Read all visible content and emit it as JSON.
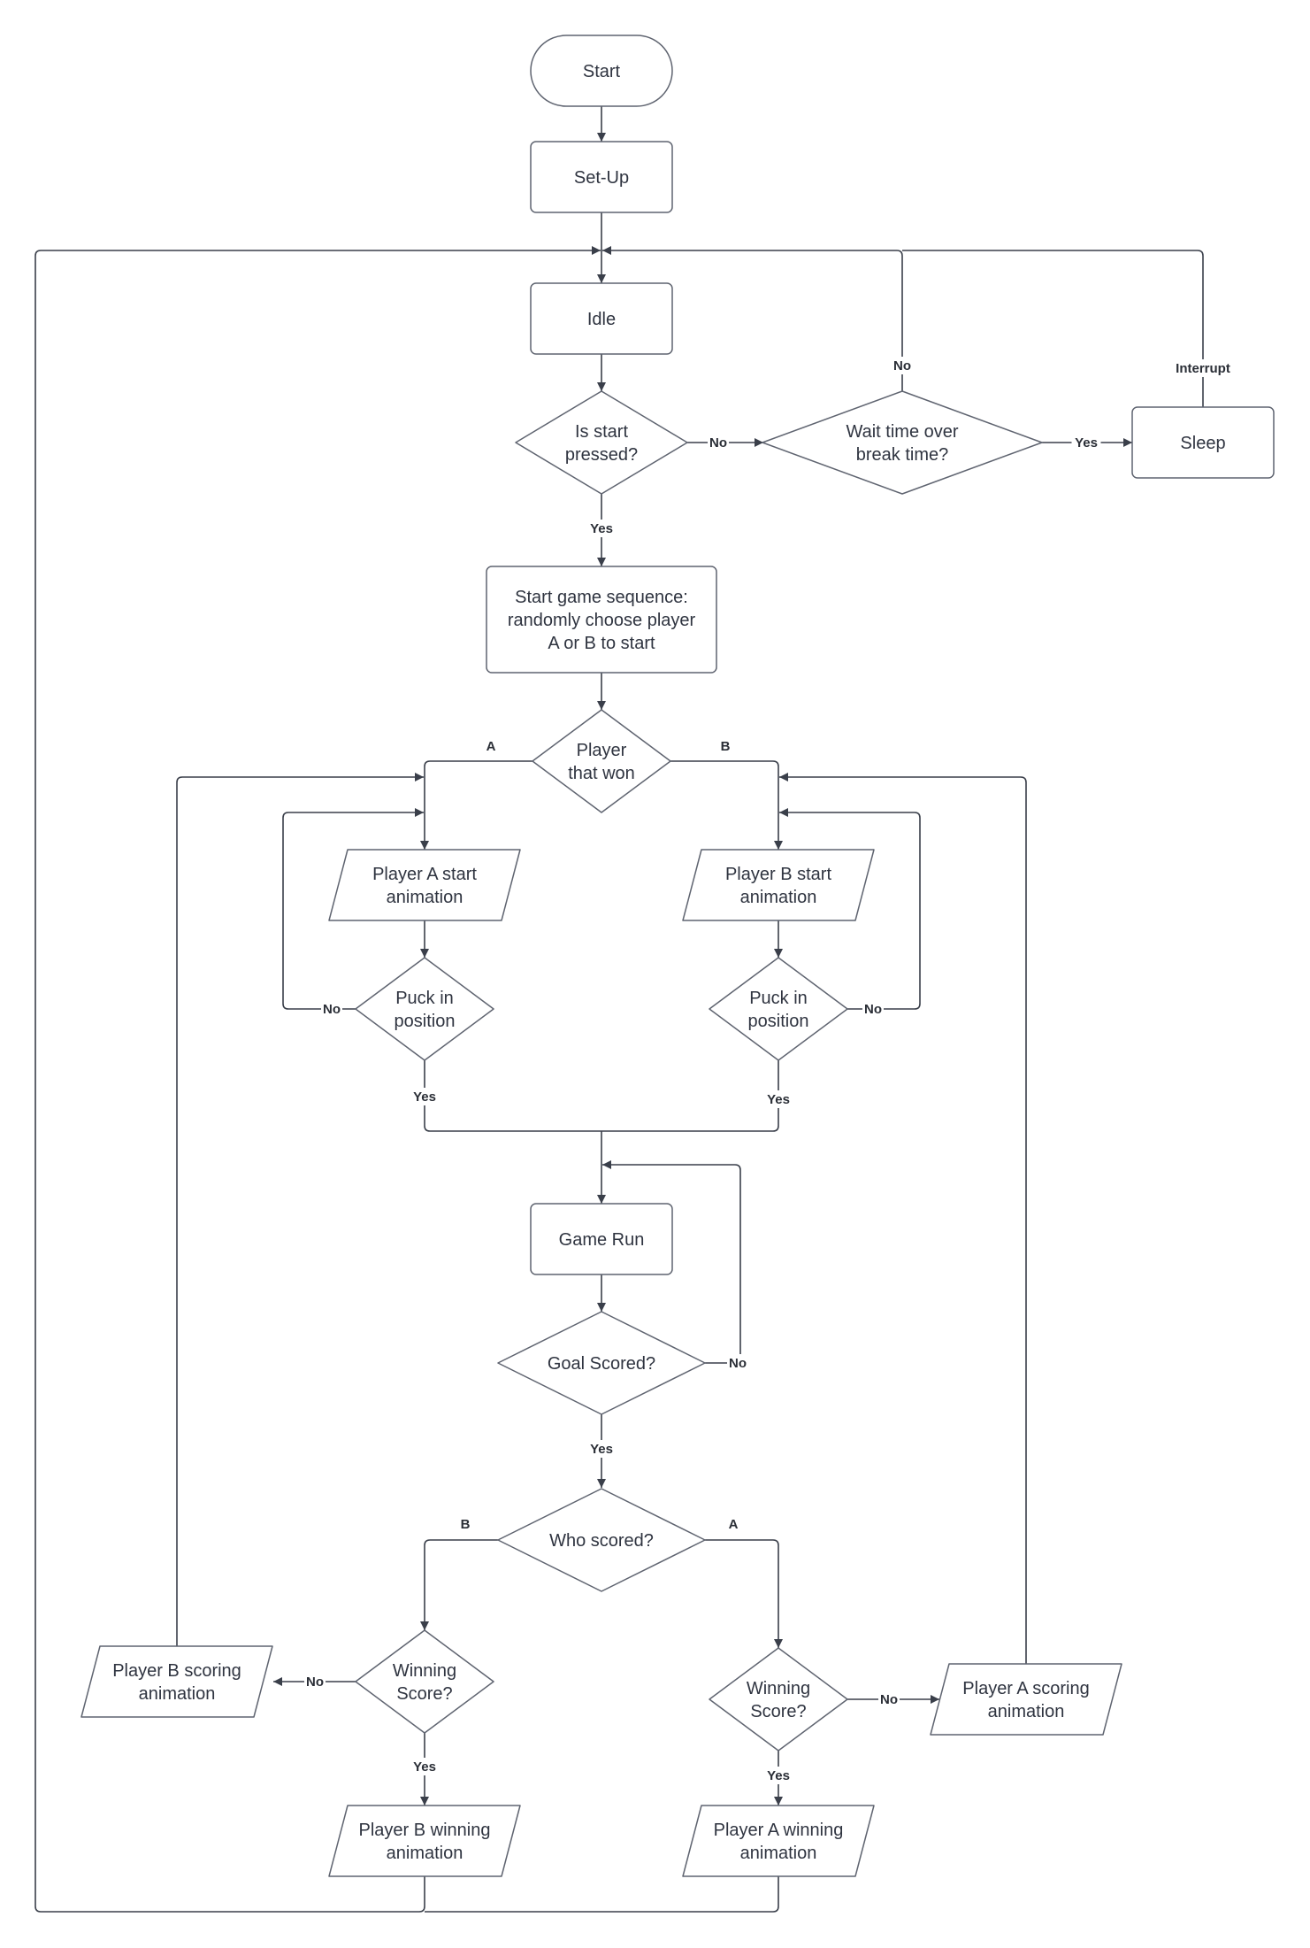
{
  "diagram": {
    "type": "flowchart",
    "nodes": {
      "start": {
        "shape": "terminator",
        "lines": [
          "Start"
        ]
      },
      "setup": {
        "shape": "process",
        "lines": [
          "Set-Up"
        ]
      },
      "idle": {
        "shape": "process",
        "lines": [
          "Idle"
        ]
      },
      "is_start_pressed": {
        "shape": "decision",
        "lines": [
          "Is start",
          "pressed?"
        ]
      },
      "wait_time": {
        "shape": "decision",
        "lines": [
          "Wait time over",
          "break time?"
        ]
      },
      "sleep": {
        "shape": "process",
        "lines": [
          "Sleep"
        ]
      },
      "start_game": {
        "shape": "process",
        "lines": [
          "Start game sequence:",
          "randomly choose player",
          "A or B to start"
        ]
      },
      "player_that_won": {
        "shape": "decision",
        "lines": [
          "Player",
          "that won"
        ]
      },
      "player_a_start": {
        "shape": "io",
        "lines": [
          "Player A start",
          "animation"
        ]
      },
      "player_b_start": {
        "shape": "io",
        "lines": [
          "Player B start",
          "animation"
        ]
      },
      "puck_a": {
        "shape": "decision",
        "lines": [
          "Puck in",
          "position"
        ]
      },
      "puck_b": {
        "shape": "decision",
        "lines": [
          "Puck in",
          "position"
        ]
      },
      "game_run": {
        "shape": "process",
        "lines": [
          "Game Run"
        ]
      },
      "goal_scored": {
        "shape": "decision",
        "lines": [
          "Goal Scored?"
        ]
      },
      "who_scored": {
        "shape": "decision",
        "lines": [
          "Who scored?"
        ]
      },
      "winning_b": {
        "shape": "decision",
        "lines": [
          "Winning",
          "Score?"
        ]
      },
      "winning_a": {
        "shape": "decision",
        "lines": [
          "Winning",
          "Score?"
        ]
      },
      "b_scoring": {
        "shape": "io",
        "lines": [
          "Player B scoring",
          "animation"
        ]
      },
      "a_scoring": {
        "shape": "io",
        "lines": [
          "Player A scoring",
          "animation"
        ]
      },
      "b_winning": {
        "shape": "io",
        "lines": [
          "Player B winning",
          "animation"
        ]
      },
      "a_winning": {
        "shape": "io",
        "lines": [
          "Player A winning",
          "animation"
        ]
      }
    },
    "edges": [
      {
        "from": "start",
        "to": "setup",
        "label": ""
      },
      {
        "from": "setup",
        "to": "idle",
        "label": ""
      },
      {
        "from": "idle",
        "to": "is_start_pressed",
        "label": ""
      },
      {
        "from": "is_start_pressed",
        "to": "wait_time",
        "label": "No"
      },
      {
        "from": "is_start_pressed",
        "to": "start_game",
        "label": "Yes"
      },
      {
        "from": "wait_time",
        "to": "idle",
        "label": "No"
      },
      {
        "from": "wait_time",
        "to": "sleep",
        "label": "Yes"
      },
      {
        "from": "sleep",
        "to": "idle",
        "label": "Interrupt"
      },
      {
        "from": "start_game",
        "to": "player_that_won",
        "label": ""
      },
      {
        "from": "player_that_won",
        "to": "player_a_start",
        "label": "A"
      },
      {
        "from": "player_that_won",
        "to": "player_b_start",
        "label": "B"
      },
      {
        "from": "player_a_start",
        "to": "puck_a",
        "label": ""
      },
      {
        "from": "player_b_start",
        "to": "puck_b",
        "label": ""
      },
      {
        "from": "puck_a",
        "to": "player_a_start",
        "label": "No"
      },
      {
        "from": "puck_b",
        "to": "player_b_start",
        "label": "No"
      },
      {
        "from": "puck_a",
        "to": "game_run",
        "label": "Yes"
      },
      {
        "from": "puck_b",
        "to": "game_run",
        "label": "Yes"
      },
      {
        "from": "game_run",
        "to": "goal_scored",
        "label": ""
      },
      {
        "from": "goal_scored",
        "to": "game_run",
        "label": "No"
      },
      {
        "from": "goal_scored",
        "to": "who_scored",
        "label": "Yes"
      },
      {
        "from": "who_scored",
        "to": "winning_b",
        "label": "B"
      },
      {
        "from": "who_scored",
        "to": "winning_a",
        "label": "A"
      },
      {
        "from": "winning_b",
        "to": "b_scoring",
        "label": "No"
      },
      {
        "from": "winning_b",
        "to": "b_winning",
        "label": "Yes"
      },
      {
        "from": "winning_a",
        "to": "a_scoring",
        "label": "No"
      },
      {
        "from": "winning_a",
        "to": "a_winning",
        "label": "Yes"
      },
      {
        "from": "b_scoring",
        "to": "player_a_start",
        "label": ""
      },
      {
        "from": "a_scoring",
        "to": "player_b_start",
        "label": ""
      },
      {
        "from": "b_winning",
        "to": "idle",
        "label": ""
      },
      {
        "from": "a_winning",
        "to": "idle",
        "label": ""
      }
    ]
  },
  "colors": {
    "shape_stroke": "#5f6470",
    "connector": "#3a3f4a",
    "text": "#2f3440",
    "background": "#ffffff"
  }
}
